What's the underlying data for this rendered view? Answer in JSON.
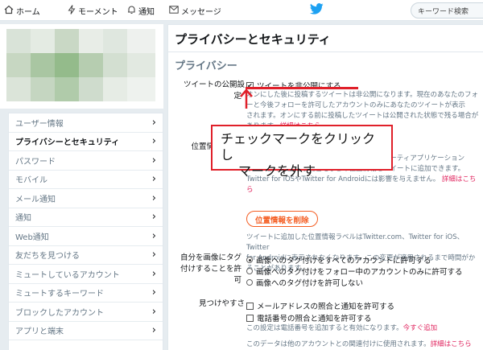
{
  "nav": {
    "home": "ホーム",
    "moments": "モーメント",
    "notifications": "通知",
    "messages": "メッセージ",
    "search_placeholder": "キーワード検索"
  },
  "sidebar": {
    "items": [
      {
        "label": "ユーザー情報"
      },
      {
        "label": "プライバシーとセキュリティ"
      },
      {
        "label": "パスワード"
      },
      {
        "label": "モバイル"
      },
      {
        "label": "メール通知"
      },
      {
        "label": "通知"
      },
      {
        "label": "Web通知"
      },
      {
        "label": "友だちを見つける"
      },
      {
        "label": "ミュートしているアカウント"
      },
      {
        "label": "ミュートするキーワード"
      },
      {
        "label": "ブロックしたアカウント"
      },
      {
        "label": "アプリと端末"
      }
    ],
    "active_index": 1
  },
  "main": {
    "title": "プライバシーとセキュリティ",
    "section": "プライバシー",
    "tweet_privacy": {
      "label_line1": "ツイートの公開設",
      "label_line2": "定",
      "checkbox_label": "ツイートを非公開にする",
      "checked": true,
      "help_line1": "オンにした後に投稿するツイートは非公開になります。現在のあなたのフォ",
      "help_line2": "ーと今後フォローを許可したアカウントのみにあなたのツイートが表示",
      "help_line3": "されます。オンにする前に投稿したツイートは公開された状態で残る場合が",
      "help_line4": "あります。",
      "help_link": "詳細はこちら"
    },
    "location": {
      "label": "位置情報をツイ",
      "help_line1": "これを有効にすると、ウェブサイトやサードパーティアプリケーション",
      "help_line2": "から、都市や正確な現在地などの位置情報をツイートに追加できます。",
      "help_line3": "Twitter for iOSやTwitter for Androidには影響を与えません。",
      "help_link": "詳細はこちら",
      "delete_button": "位置情報を削除",
      "note_line1": "ツイートに追加した位置情報ラベルはTwitter.com、Twitter for iOS、Twitter",
      "note_line2": "for Androidに表示されなくなります。この変更が適用されるまで時間がか",
      "note_line3": "ることがあります。"
    },
    "photo_tagging": {
      "label_line1": "自分を画像にタグ",
      "label_line2": "付けすることを許",
      "label_line3": "可",
      "options": [
        {
          "label": "画像へのタグ付けをすべてのアカウントに許可する",
          "selected": true
        },
        {
          "label": "画像へのタグ付けをフォロー中のアカウントのみに許可する",
          "selected": false
        },
        {
          "label": "画像へのタグ付けを許可しない",
          "selected": false
        }
      ]
    },
    "discoverability": {
      "label": "見つけやすさ",
      "email_option": "メールアドレスの照合と通知を許可する",
      "phone_option": "電話番号の照合と通知を許可する",
      "help1": "この設定は電話番号を追加すると有効になります。",
      "help1_link": "今すぐ追加",
      "help2": "このデータは他のアカウントとの関連付けに使用されます。",
      "help2_link": "詳細はこちら"
    }
  },
  "annotation": {
    "line1": "チェックマークをクリックし",
    "line2": "マークを外す"
  },
  "colors": {
    "accent": "#e0202a",
    "link": "#e0245e",
    "orange": "#f45d22",
    "twitter_blue": "#1da1f2"
  }
}
